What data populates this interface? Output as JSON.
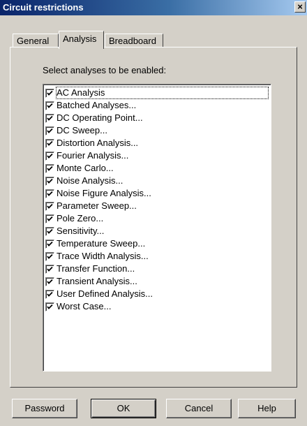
{
  "window": {
    "title": "Circuit restrictions",
    "close_label": "×"
  },
  "tabs": [
    {
      "label": "General",
      "active": false
    },
    {
      "label": "Analysis",
      "active": true
    },
    {
      "label": "Breadboard",
      "active": false
    }
  ],
  "analysis_panel": {
    "instruction": "Select analyses to be enabled:",
    "items": [
      {
        "label": "AC Analysis",
        "checked": true,
        "focused": true
      },
      {
        "label": "Batched Analyses...",
        "checked": true
      },
      {
        "label": "DC Operating Point...",
        "checked": true
      },
      {
        "label": "DC Sweep...",
        "checked": true
      },
      {
        "label": "Distortion Analysis...",
        "checked": true
      },
      {
        "label": "Fourier Analysis...",
        "checked": true
      },
      {
        "label": "Monte Carlo...",
        "checked": true
      },
      {
        "label": "Noise Analysis...",
        "checked": true
      },
      {
        "label": "Noise Figure Analysis...",
        "checked": true
      },
      {
        "label": "Parameter Sweep...",
        "checked": true
      },
      {
        "label": "Pole Zero...",
        "checked": true
      },
      {
        "label": "Sensitivity...",
        "checked": true
      },
      {
        "label": "Temperature Sweep...",
        "checked": true
      },
      {
        "label": "Trace Width Analysis...",
        "checked": true
      },
      {
        "label": "Transfer Function...",
        "checked": true
      },
      {
        "label": "Transient Analysis...",
        "checked": true
      },
      {
        "label": "User Defined Analysis...",
        "checked": true
      },
      {
        "label": "Worst Case...",
        "checked": true
      }
    ]
  },
  "buttons": {
    "password": "Password",
    "ok": "OK",
    "cancel": "Cancel",
    "help": "Help"
  }
}
